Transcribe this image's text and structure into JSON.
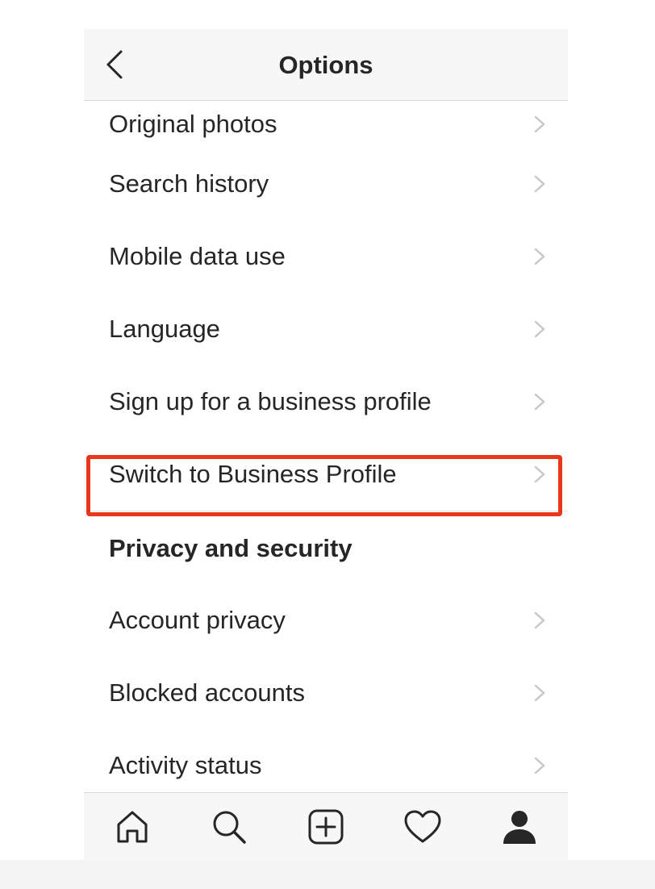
{
  "header": {
    "title": "Options",
    "back_icon": "chevron-left-icon"
  },
  "settings": {
    "items": [
      {
        "label": "Original photos"
      },
      {
        "label": "Search history"
      },
      {
        "label": "Mobile data use"
      },
      {
        "label": "Language"
      },
      {
        "label": "Sign up for a business profile"
      },
      {
        "label": "Switch to Business Profile",
        "highlighted": true
      }
    ]
  },
  "privacy": {
    "section_title": "Privacy and security",
    "items": [
      {
        "label": "Account privacy"
      },
      {
        "label": "Blocked accounts"
      },
      {
        "label": "Activity status"
      }
    ]
  },
  "tabbar": {
    "tabs": [
      {
        "icon": "home-icon"
      },
      {
        "icon": "search-icon"
      },
      {
        "icon": "new-post-icon"
      },
      {
        "icon": "heart-icon"
      },
      {
        "icon": "profile-icon",
        "active": true
      }
    ]
  },
  "colors": {
    "highlight": "#e8371c",
    "text": "#262626",
    "chevron": "#c7c7cc",
    "bar_background": "#f7f7f7"
  }
}
